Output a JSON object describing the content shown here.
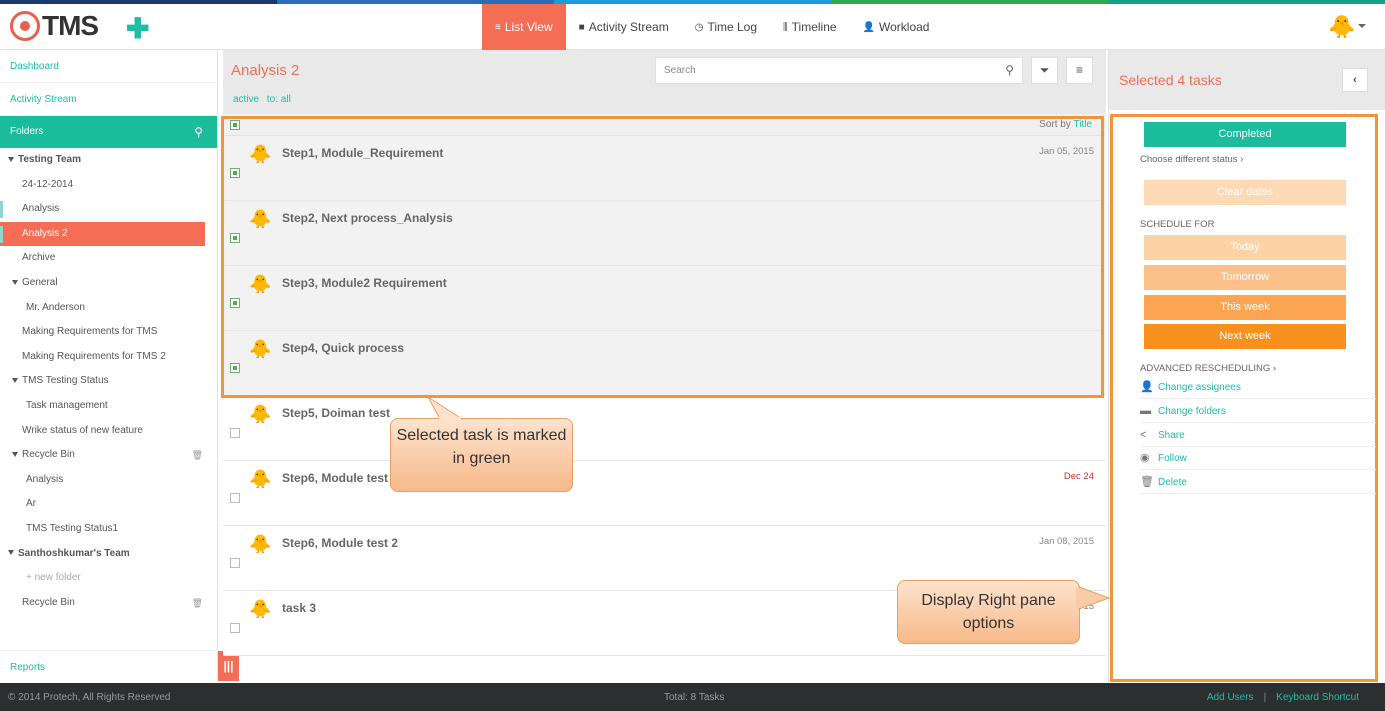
{
  "colors": {
    "accent": "#f46d54",
    "teal": "#1abc9c",
    "highlight": "#f2953a"
  },
  "top_stripe": [
    "#1b3a6b",
    "#2d6db8",
    "#1e9bd7",
    "#2fa84f",
    "#16a085"
  ],
  "header": {
    "logo_text": "TMS",
    "add_icon": "plus-icon",
    "nav": [
      {
        "label": "List View",
        "icon": "list-icon",
        "glyph": "≡",
        "active": true
      },
      {
        "label": "Activity Stream",
        "icon": "comment-icon",
        "glyph": "■"
      },
      {
        "label": "Time Log",
        "icon": "clock-icon",
        "glyph": "◷"
      },
      {
        "label": "Timeline",
        "icon": "sliders-icon",
        "glyph": "⫼"
      },
      {
        "label": "Workload",
        "icon": "user-icon",
        "glyph": "👤"
      }
    ]
  },
  "sidebar": {
    "dashboard": "Dashboard",
    "activity_stream": "Activity Stream",
    "folders": "Folders",
    "reports": "Reports",
    "tree": [
      {
        "label": "Testing Team",
        "indent": 0,
        "bold": true,
        "expanded": true
      },
      {
        "label": "24-12-2014",
        "indent": 1
      },
      {
        "label": "Analysis",
        "indent": 1,
        "marker": true
      },
      {
        "label": "Analysis 2",
        "indent": 1,
        "selected": true,
        "marker": true
      },
      {
        "label": "Archive",
        "indent": 1
      },
      {
        "label": "General",
        "indent": 1,
        "expanded": true
      },
      {
        "label": "Mr. Anderson",
        "indent": 2
      },
      {
        "label": "Making Requirements for TMS",
        "indent": 1
      },
      {
        "label": "Making Requirements for TMS 2",
        "indent": 1
      },
      {
        "label": "TMS Testing Status",
        "indent": 1,
        "expanded": true
      },
      {
        "label": "Task management",
        "indent": 2
      },
      {
        "label": "Wrike status of new feature",
        "indent": 1
      },
      {
        "label": "Recycle Bin",
        "indent": 1,
        "expanded": true,
        "trash": true
      },
      {
        "label": "Analysis",
        "indent": 2
      },
      {
        "label": "Ar",
        "indent": 2
      },
      {
        "label": "TMS Testing Status1",
        "indent": 2
      },
      {
        "label": "Santhoshkumar's Team",
        "indent": 0,
        "bold": true,
        "expanded": true
      },
      {
        "label": "+ new folder",
        "indent": 2,
        "muted": true
      },
      {
        "label": "Recycle Bin",
        "indent": 1,
        "trash": true
      }
    ]
  },
  "main": {
    "title": "Analysis 2",
    "search_placeholder": "Search",
    "tags": [
      "active",
      "to: all"
    ],
    "sort_prefix": "Sort by",
    "sort_field": "Title",
    "tasks": [
      {
        "title": "Step1, Module_Requirement",
        "date": "Jan 05, 2015",
        "selected": true
      },
      {
        "title": "Step2, Next process_Analysis",
        "date": "",
        "selected": true
      },
      {
        "title": "Step3, Module2 Requirement",
        "date": "",
        "selected": true
      },
      {
        "title": "Step4, Quick process",
        "date": "",
        "selected": true
      },
      {
        "title": "Step5, Doiman test",
        "date": "",
        "selected": false
      },
      {
        "title": "Step6, Module test 1",
        "date": "Dec 24",
        "overdue": true,
        "selected": false
      },
      {
        "title": "Step6, Module test 2",
        "date": "Jan 08, 2015",
        "selected": false
      },
      {
        "title": "task 3",
        "date": "15",
        "selected": false
      }
    ]
  },
  "right_pane": {
    "selected_count": "Selected 4 tasks",
    "status": "Completed",
    "choose_status": "Choose different status",
    "clear_dates": "Clear dates",
    "schedule_for": "SCHEDULE FOR",
    "schedule": [
      {
        "label": "Today",
        "color": "#fcd3a5"
      },
      {
        "label": "Tomorrow",
        "color": "#fcc08a"
      },
      {
        "label": "This week",
        "color": "#fba553"
      },
      {
        "label": "Next week",
        "color": "#f8901d"
      }
    ],
    "advanced": "ADVANCED RESCHEDULING",
    "actions": [
      {
        "label": "Change assignees",
        "icon": "user-icon",
        "glyph": "👤"
      },
      {
        "label": "Change folders",
        "icon": "folder-icon",
        "glyph": "▬"
      },
      {
        "label": "Share",
        "icon": "share-icon",
        "glyph": "<"
      },
      {
        "label": "Follow",
        "icon": "rss-icon",
        "glyph": "◉"
      },
      {
        "label": "Delete",
        "icon": "trash-icon",
        "glyph": "🗑"
      }
    ]
  },
  "callouts": {
    "selected_task": "Selected task is marked in green",
    "right_pane": "Display Right pane options"
  },
  "footer": {
    "copyright": "© 2014 Protech, All Rights Reserved",
    "total": "Total: 8 Tasks",
    "add_users": "Add Users",
    "separator": "|",
    "keyboard_shortcut": "Keyboard Shortcut"
  }
}
